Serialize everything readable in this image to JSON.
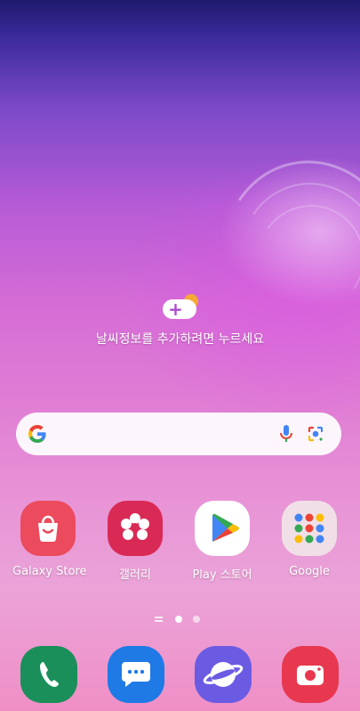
{
  "weather_widget": {
    "prompt": "날씨정보를 추가하려면 누르세요"
  },
  "search_bar": {
    "logo": "G",
    "mic_icon": "microphone-icon",
    "lens_icon": "google-lens-icon"
  },
  "page_indicator": {
    "pages": 2,
    "active_page": 1
  },
  "apps": [
    {
      "label": "Galaxy Store",
      "icon": "galaxy-store-icon",
      "color": "#ec4a5d"
    },
    {
      "label": "갤러리",
      "icon": "gallery-icon",
      "color": "#d92a55"
    },
    {
      "label": "Play 스토어",
      "icon": "play-store-icon",
      "color": "#ffffff"
    },
    {
      "label": "Google",
      "icon": "google-folder-icon",
      "color": "#f1dfe7"
    }
  ],
  "dock": [
    {
      "icon": "phone-icon",
      "color": "#1a8f5a"
    },
    {
      "icon": "messages-icon",
      "color": "#1f7ae6"
    },
    {
      "icon": "internet-icon",
      "color": "#6b5be3"
    },
    {
      "icon": "camera-icon",
      "color": "#e8384f"
    }
  ]
}
